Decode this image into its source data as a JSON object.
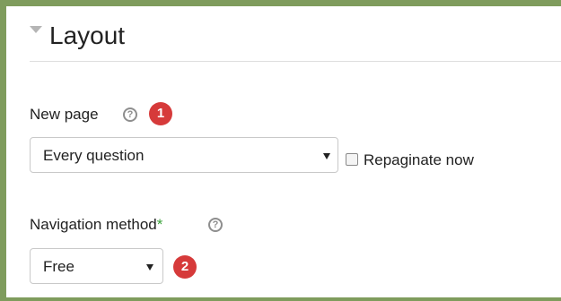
{
  "section": {
    "title": "Layout"
  },
  "fields": {
    "new_page": {
      "label": "New page",
      "help_icon": "help-icon",
      "badge": "1",
      "selected": "Every question",
      "checkbox_label": "Repaginate now",
      "checkbox_checked": false
    },
    "navigation": {
      "label": "Navigation method",
      "required_marker": "*",
      "help_icon": "help-icon",
      "badge": "2",
      "selected": "Free"
    }
  },
  "colors": {
    "frame": "#7f9c5d",
    "badge": "#d63a3a",
    "required": "#3aa23a"
  }
}
